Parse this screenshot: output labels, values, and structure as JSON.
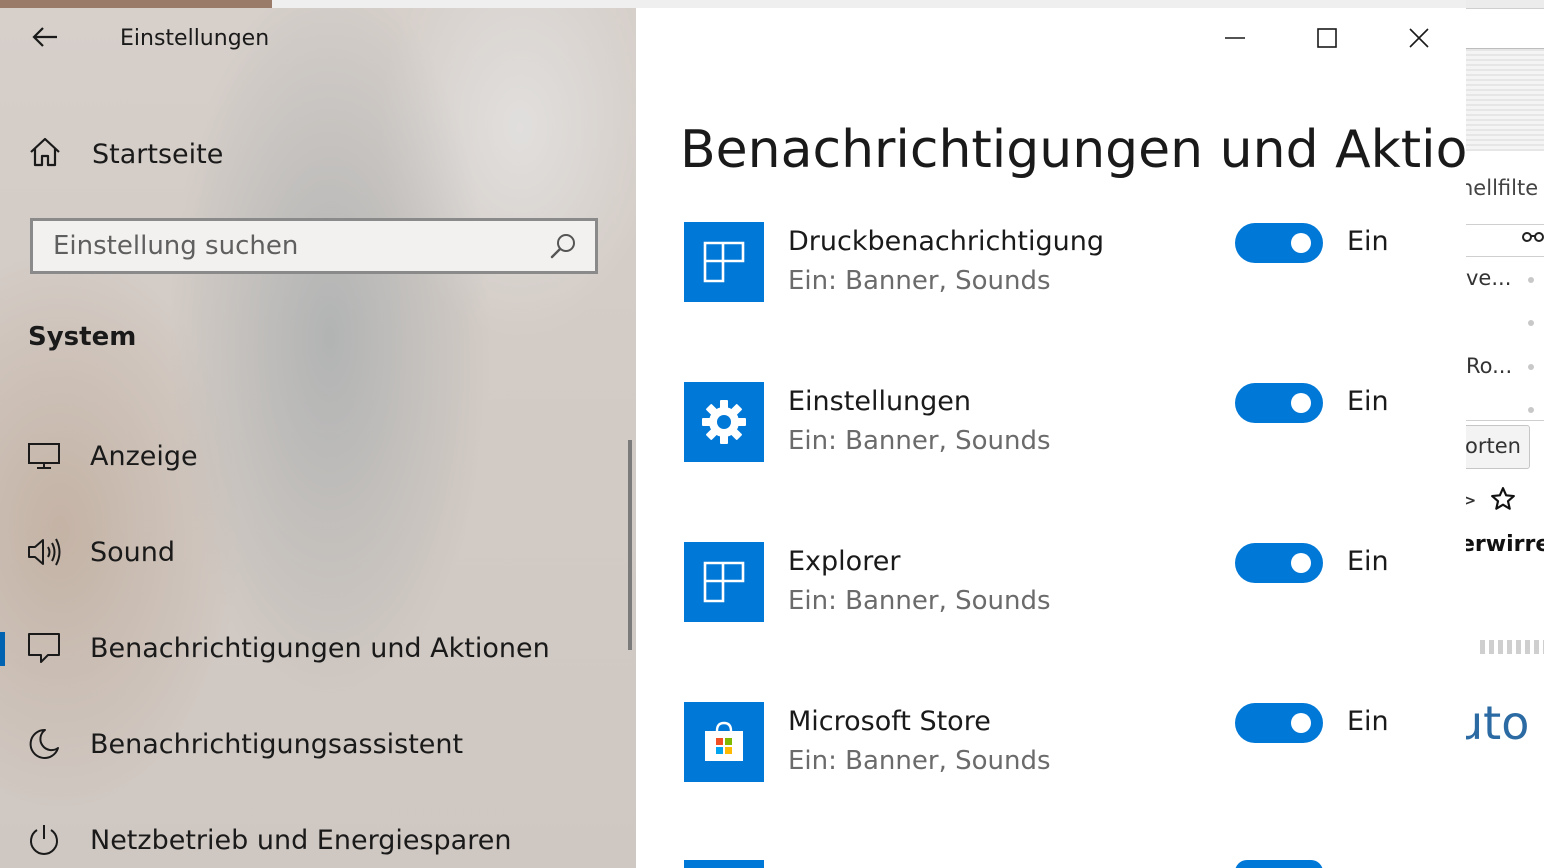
{
  "window": {
    "title": "Einstellungen",
    "controls": {
      "minimize": "minimize-icon",
      "maximize": "maximize-icon",
      "close": "close-icon"
    }
  },
  "nav": {
    "home_label": "Startseite",
    "search": {
      "placeholder": "Einstellung suchen",
      "value": ""
    },
    "section": "System",
    "items": [
      {
        "label": "Anzeige",
        "icon": "monitor-icon",
        "selected": false
      },
      {
        "label": "Sound",
        "icon": "speaker-icon",
        "selected": false
      },
      {
        "label": "Benachrichtigungen und Aktionen",
        "icon": "notification-icon",
        "selected": true
      },
      {
        "label": "Benachrichtigungsassistent",
        "icon": "moon-icon",
        "selected": false
      },
      {
        "label": "Netzbetrieb und Energiesparen",
        "icon": "power-icon",
        "selected": false
      }
    ]
  },
  "content": {
    "page_title": "Benachrichtigungen und Aktione",
    "apps": [
      {
        "name": "Druckbenachrichtigung",
        "status": "Ein: Banner, Sounds",
        "toggle_label": "Ein",
        "toggle_on": true,
        "icon": "app-tiles-icon"
      },
      {
        "name": "Einstellungen",
        "status": "Ein: Banner, Sounds",
        "toggle_label": "Ein",
        "toggle_on": true,
        "icon": "gear-icon"
      },
      {
        "name": "Explorer",
        "status": "Ein: Banner, Sounds",
        "toggle_label": "Ein",
        "toggle_on": true,
        "icon": "app-tiles-icon"
      },
      {
        "name": "Microsoft Store",
        "status": "Ein: Banner, Sounds",
        "toggle_label": "Ein",
        "toggle_on": true,
        "icon": "store-icon"
      }
    ]
  },
  "background_window": {
    "texts": [
      "nellfilte",
      "ve...",
      "Ro...",
      "orten",
      ">",
      "erwirre",
      "uto"
    ]
  },
  "colors": {
    "accent": "#0078d7",
    "selection_bar": "#0063b1"
  }
}
